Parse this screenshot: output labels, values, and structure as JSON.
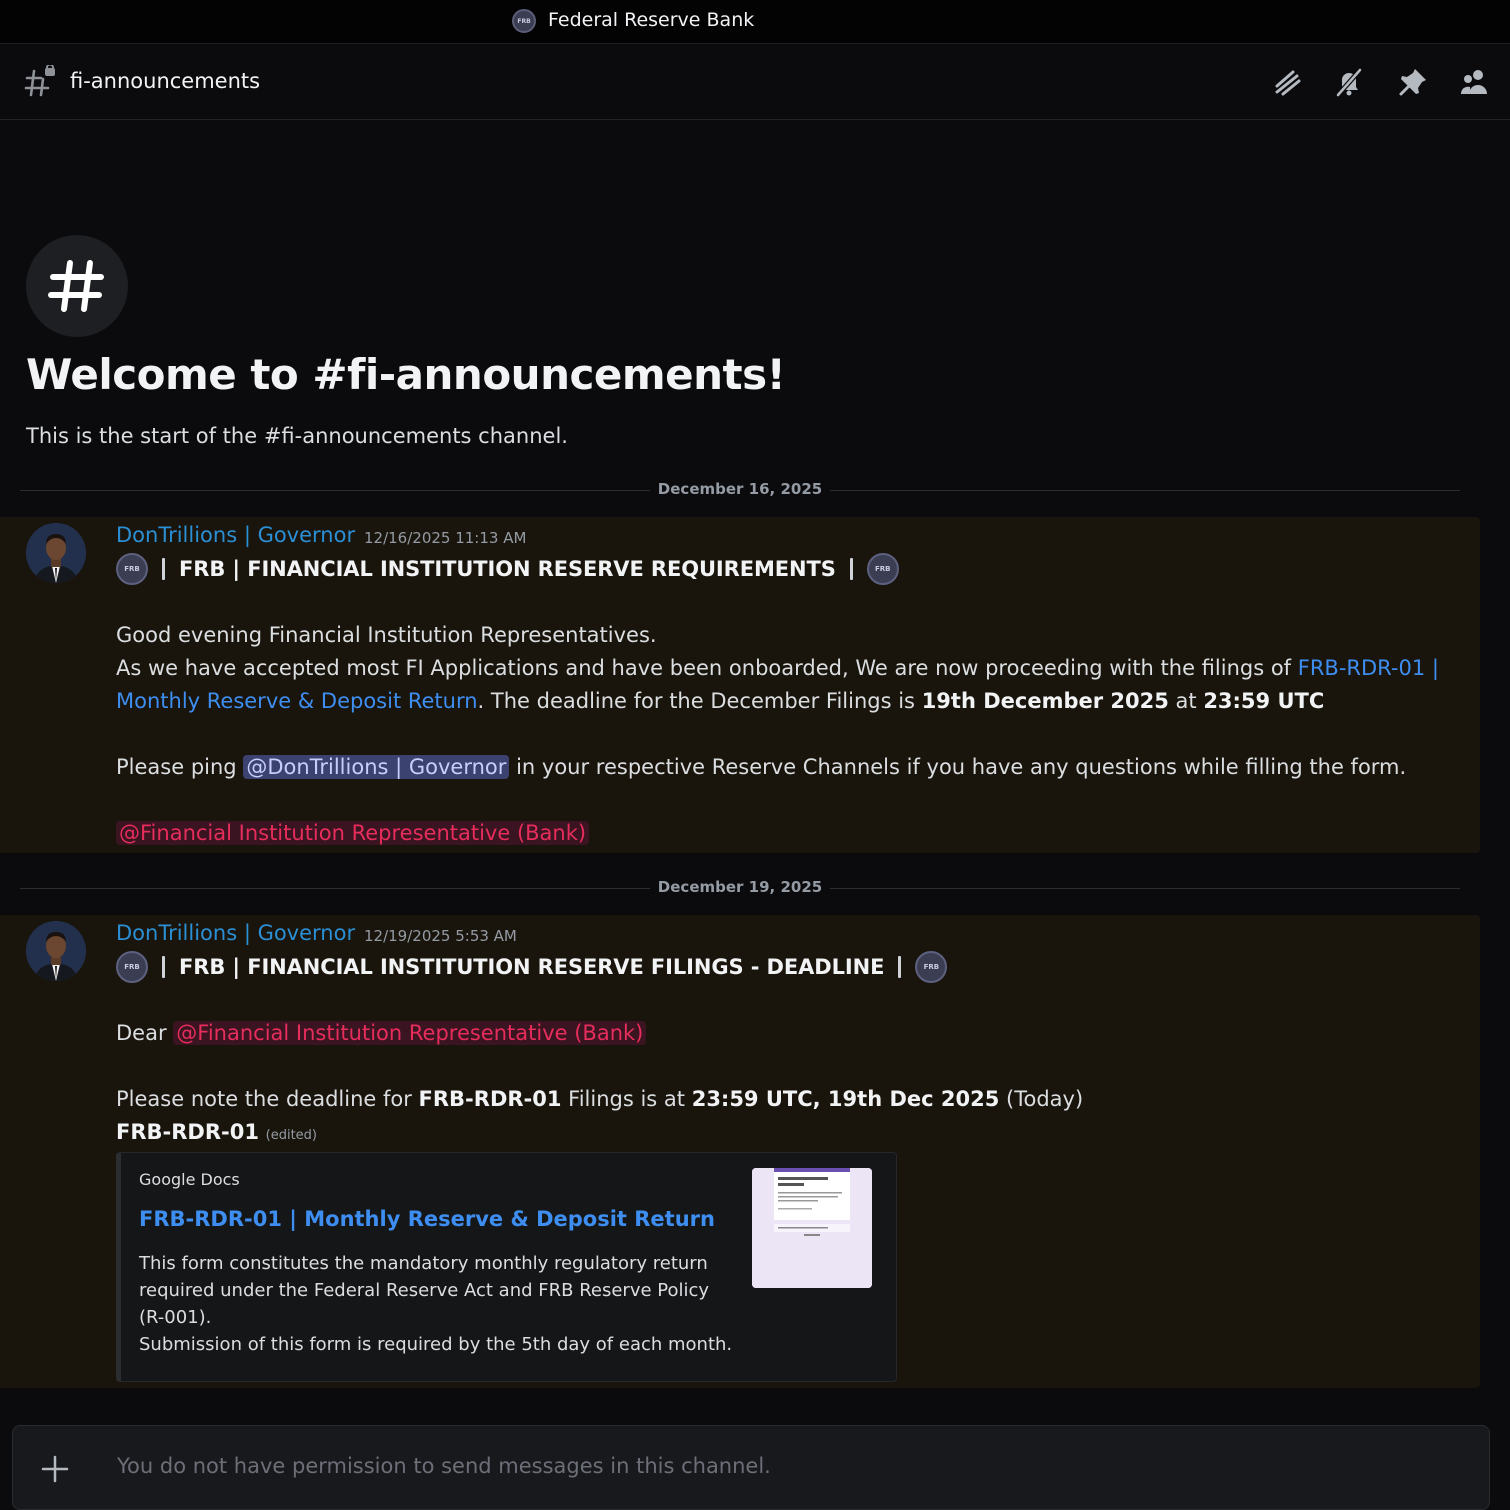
{
  "server": {
    "name": "Federal Reserve Bank",
    "badge": "FRB"
  },
  "channel": {
    "name": "fi-announcements",
    "icons": [
      "threads-icon",
      "mute-bell-icon",
      "pin-icon",
      "members-icon"
    ]
  },
  "welcome": {
    "title": "Welcome to #fi-announcements!",
    "subtitle": "This is the start of the #fi-announcements channel."
  },
  "messages": [
    {
      "date_divider": "December 16, 2025",
      "author": "DonTrillions | Governor",
      "timestamp": "12/16/2025 11:13 AM",
      "emoji_text": "FRB",
      "headline": "FRB | FINANCIAL INSTITUTION RESERVE REQUIREMENTS",
      "greeting": "Good evening Financial Institution Representatives.",
      "line2_prefix": "As we have accepted most FI Applications and have been onboarded, We are now proceeding with the filings of ",
      "line2_link_part1": "FRB-RDR-01 |",
      "line3_link_part2": "Monthly Reserve & Deposit Return",
      "line3_mid": ". The deadline for the December Filings is ",
      "line3_bold_date": "19th December 2025",
      "line3_at": " at ",
      "line3_bold_time": "23:59 UTC",
      "line4_prefix": "Please ping ",
      "line4_mention": "@DonTrillions | Governor",
      "line4_suffix": " in your respective Reserve Channels if you have any questions while filling the form.",
      "role_mention": "@Financial Institution Representative (Bank)"
    },
    {
      "date_divider": "December 19, 2025",
      "author": "DonTrillions | Governor",
      "timestamp": "12/19/2025 5:53 AM",
      "emoji_text": "FRB",
      "headline": "FRB | FINANCIAL INSTITUTION RESERVE FILINGS - DEADLINE",
      "dear": "Dear ",
      "role_mention": "@Financial Institution Representative (Bank)",
      "note_prefix": "Please note the deadline for ",
      "note_bold_form": "FRB-RDR-01",
      "note_mid": " Filings is at ",
      "note_bold_time": "23:59 UTC, 19th Dec 2025",
      "note_suffix": " (Today)",
      "link_label": "FRB-RDR-01",
      "edited_label": "(edited)",
      "embed": {
        "provider": "Google Docs",
        "title": "FRB-RDR-01 | Monthly Reserve & Deposit Return",
        "description_1": "This form constitutes the mandatory monthly regulatory return required under the Federal Reserve Act and FRB Reserve Policy (R-001).",
        "description_2": "Submission of this form is required by the 5th day of each month."
      }
    }
  ],
  "composer": {
    "placeholder": "You do not have permission to send messages in this channel."
  }
}
